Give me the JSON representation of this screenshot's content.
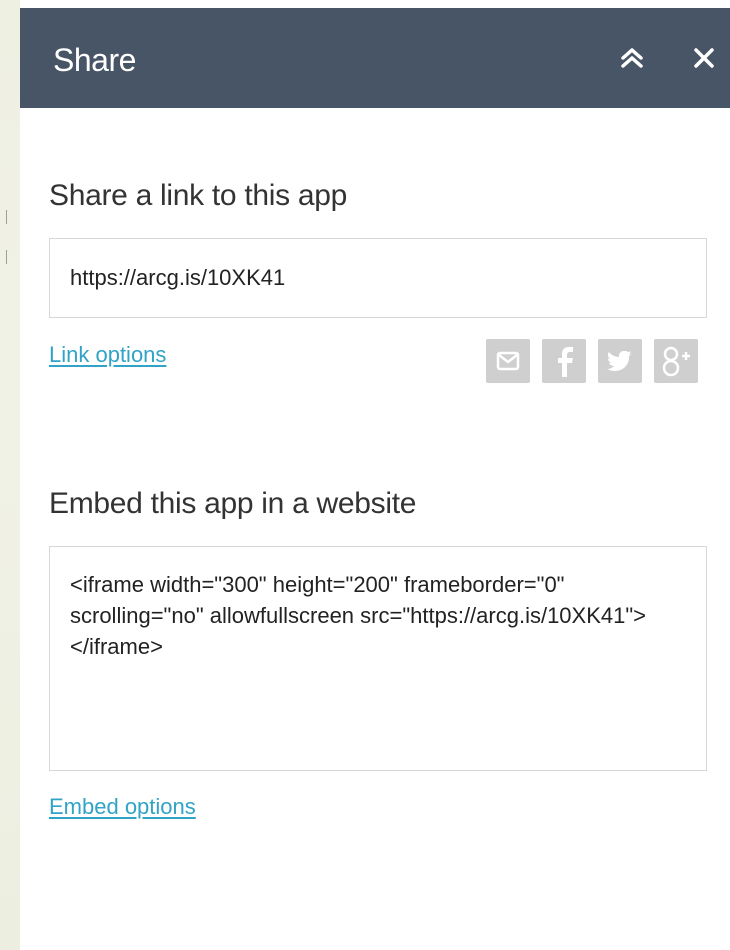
{
  "panel": {
    "title": "Share"
  },
  "link_section": {
    "heading": "Share a link to this app",
    "url_value": "https://arcg.is/10XK41",
    "options_label": "Link options"
  },
  "social_icons": [
    "email-icon",
    "facebook-icon",
    "twitter-icon",
    "google-plus-icon"
  ],
  "embed_section": {
    "heading": "Embed this app in a website",
    "code_value": "<iframe width=\"300\" height=\"200\" frameborder=\"0\" scrolling=\"no\" allowfullscreen src=\"https://arcg.is/10XK41\"></iframe>",
    "options_label": "Embed options"
  },
  "colors": {
    "header_bg": "#485566",
    "link": "#31a3c6",
    "social_icon_bg": "#cfcfcf"
  }
}
